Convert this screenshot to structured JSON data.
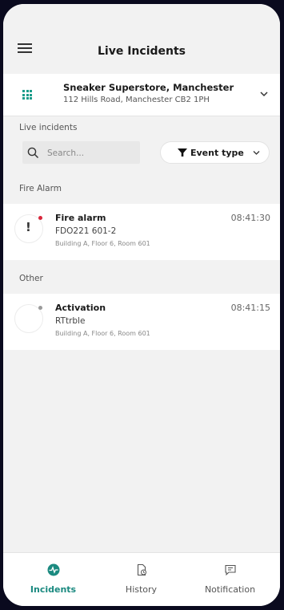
{
  "header": {
    "title": "Live Incidents",
    "menu_icon": "hamburger-menu-icon"
  },
  "site": {
    "name": "Sneaker Superstore, Manchester",
    "address": "112 Hills Road, Manchester CB2 1PH",
    "icon": "building-grid-icon"
  },
  "live_incidents_label": "Live incidents",
  "search": {
    "placeholder": "Search..."
  },
  "filter": {
    "label": "Event type"
  },
  "groups": [
    {
      "label": "Fire Alarm",
      "incidents": [
        {
          "title": "Fire alarm",
          "code": "FDO221 601-2",
          "location": "Building A, Floor 6, Room 601",
          "time": "08:41:30",
          "icon": "exclamation-icon",
          "status_color": "#d9263b"
        }
      ]
    },
    {
      "label": "Other",
      "incidents": [
        {
          "title": "Activation",
          "code": "RTtrble",
          "location": "Building A, Floor 6, Room 601",
          "time": "08:41:15",
          "icon": "empty-circle-icon",
          "status_color": "#9a9a9a"
        }
      ]
    }
  ],
  "nav": {
    "items": [
      {
        "label": "Incidents",
        "icon": "pulse-icon",
        "active": true
      },
      {
        "label": "History",
        "icon": "history-document-icon",
        "active": false
      },
      {
        "label": "Notification",
        "icon": "message-icon",
        "active": false
      }
    ]
  },
  "colors": {
    "accent": "#1b8a80",
    "alarm": "#d9263b",
    "background": "#f2f2f2"
  }
}
